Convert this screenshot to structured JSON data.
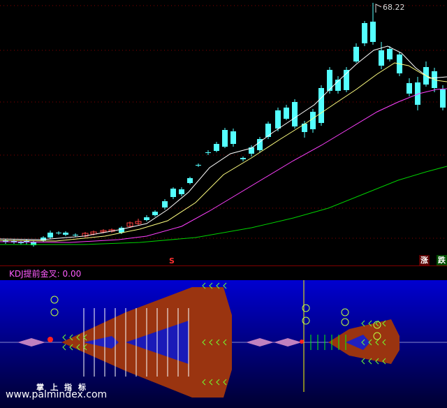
{
  "main_chart": {
    "high_price_label": "68.22",
    "signal_marker": "S",
    "badges": {
      "rise": "涨",
      "fall": "跌"
    },
    "colors": {
      "background": "#000000",
      "grid_dotted": "#8b0000",
      "candle_up": "#ff4040",
      "candle_down": "#54ffff",
      "ma_short": "#ffffff",
      "ma_mid": "#ffff80",
      "ma_long": "#ff40ff",
      "ma_longest": "#00d000"
    }
  },
  "sub_panel": {
    "indicator_title": "KDJ提前金叉: 0.00",
    "colors": {
      "background_top": "#0000d0",
      "background_bottom": "#000030",
      "fill_brown": "#9a3410",
      "bar_white": "#ffffff",
      "bar_yellow": "#ffff00",
      "line_green": "#00ff00",
      "diamond_pink": "#c080c0"
    }
  },
  "watermark": {
    "brand_name": "掌上指标",
    "url": "www.palmindex.com"
  }
}
